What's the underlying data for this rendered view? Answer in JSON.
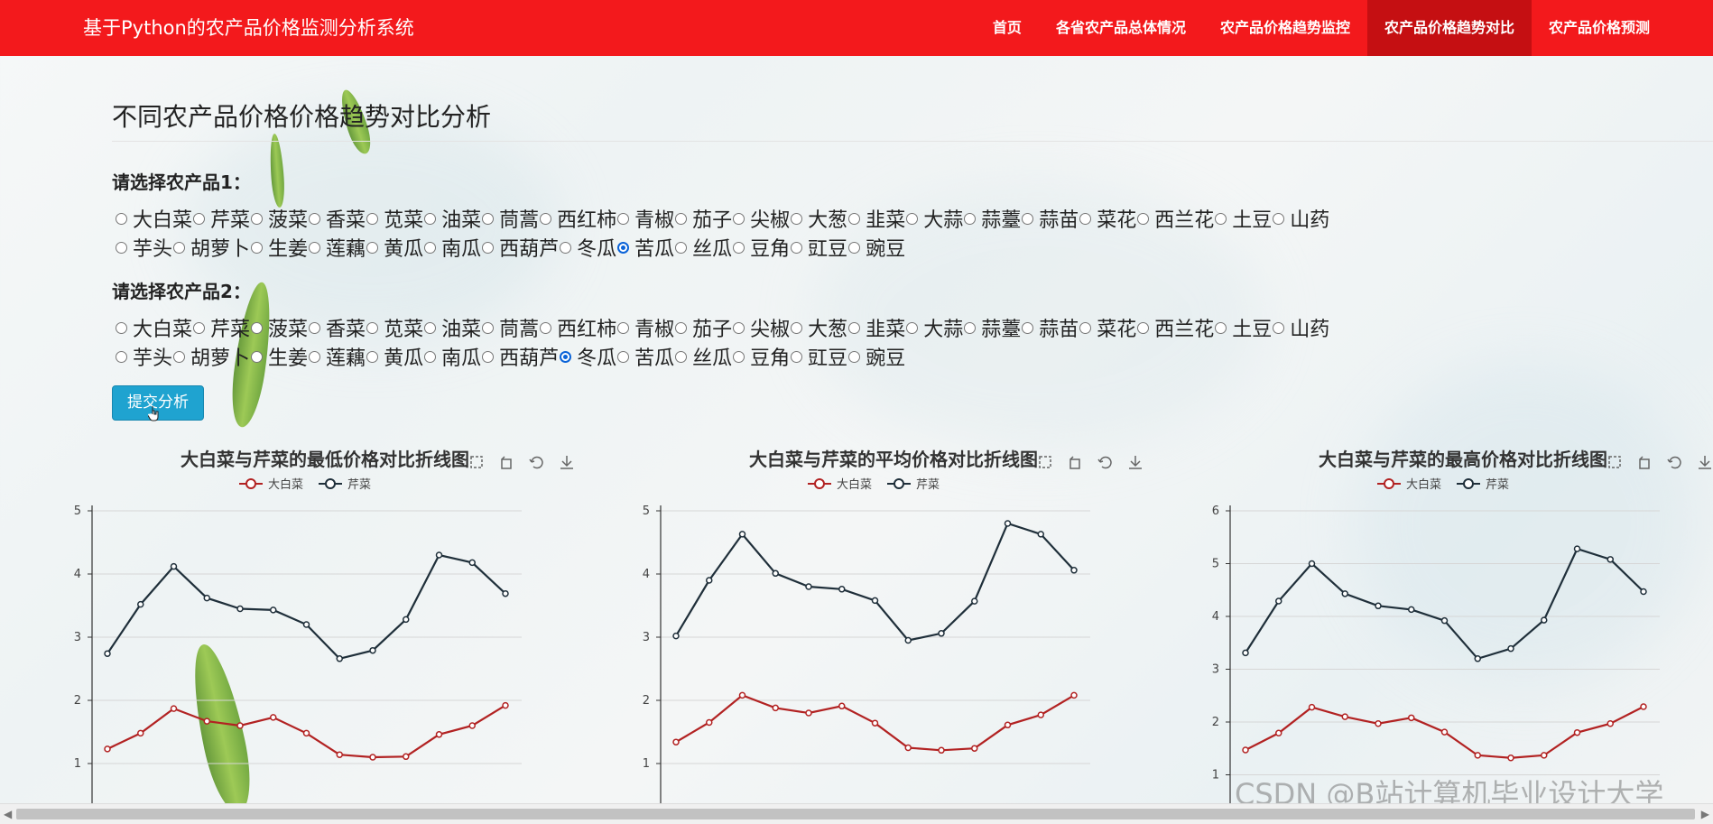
{
  "navbar": {
    "brand": "基于Python的农产品价格监测分析系统",
    "items": [
      {
        "label": "首页",
        "active": false
      },
      {
        "label": "各省农产品总体情况",
        "active": false
      },
      {
        "label": "农产品价格趋势监控",
        "active": false
      },
      {
        "label": "农产品价格趋势对比",
        "active": true
      },
      {
        "label": "农产品价格预测",
        "active": false
      }
    ]
  },
  "page_title": "不同农产品价格价格趋势对比分析",
  "product1": {
    "label": "请选择农产品1：",
    "selected": "苦瓜"
  },
  "product2": {
    "label": "请选择农产品2：",
    "selected": "冬瓜"
  },
  "options_row1": [
    "大白菜",
    "芹菜",
    "菠菜",
    "香菜",
    "苋菜",
    "油菜",
    "茼蒿",
    "西红柿",
    "青椒",
    "茄子",
    "尖椒",
    "大葱",
    "韭菜",
    "大蒜",
    "蒜薹",
    "蒜苗",
    "菜花",
    "西兰花",
    "土豆",
    "山药"
  ],
  "options_row2": [
    "芋头",
    "胡萝卜",
    "生姜",
    "莲藕",
    "黄瓜",
    "南瓜",
    "西葫芦",
    "冬瓜",
    "苦瓜",
    "丝瓜",
    "豆角",
    "豇豆",
    "豌豆"
  ],
  "submit_label": "提交分析",
  "colors": {
    "navbar": "#f3191c",
    "nav_active": "#c50f12",
    "series1": "#b22222",
    "series2": "#1f2f3a",
    "button": "#1fa3d0"
  },
  "chart_data": [
    {
      "type": "line",
      "title": "大白菜与芹菜的最低价格对比折线图",
      "ylim": [
        0,
        5
      ],
      "yticks": [
        1,
        2,
        3,
        4,
        5
      ],
      "series": [
        {
          "name": "大白菜",
          "values": [
            1.23,
            1.48,
            1.87,
            1.67,
            1.6,
            1.73,
            1.48,
            1.14,
            1.1,
            1.11,
            1.46,
            1.6,
            1.92
          ]
        },
        {
          "name": "芹菜",
          "values": [
            2.74,
            3.52,
            4.12,
            3.62,
            3.45,
            3.43,
            3.2,
            2.66,
            2.79,
            3.28,
            4.3,
            4.18,
            3.69
          ]
        }
      ],
      "legend": "top-center",
      "toolbox": [
        "zoom-icon",
        "zoom-reset-icon",
        "refresh-icon",
        "download-icon"
      ]
    },
    {
      "type": "line",
      "title": "大白菜与芹菜的平均价格对比折线图",
      "ylim": [
        0,
        5
      ],
      "yticks": [
        1,
        2,
        3,
        4,
        5
      ],
      "series": [
        {
          "name": "大白菜",
          "values": [
            1.34,
            1.65,
            2.08,
            1.88,
            1.8,
            1.91,
            1.64,
            1.25,
            1.21,
            1.24,
            1.61,
            1.77,
            2.08
          ]
        },
        {
          "name": "芹菜",
          "values": [
            3.02,
            3.9,
            4.63,
            4.01,
            3.8,
            3.76,
            3.58,
            2.95,
            3.06,
            3.57,
            4.8,
            4.63,
            4.06
          ]
        }
      ],
      "legend": "top-center",
      "toolbox": [
        "zoom-icon",
        "zoom-reset-icon",
        "refresh-icon",
        "download-icon"
      ]
    },
    {
      "type": "line",
      "title": "大白菜与芹菜的最高价格对比折线图",
      "ylim": [
        0,
        6
      ],
      "yticks": [
        1,
        2,
        3,
        4,
        5,
        6
      ],
      "series": [
        {
          "name": "大白菜",
          "values": [
            1.47,
            1.79,
            2.28,
            2.1,
            1.97,
            2.08,
            1.81,
            1.37,
            1.32,
            1.37,
            1.8,
            1.97,
            2.29
          ]
        },
        {
          "name": "芹菜",
          "values": [
            3.31,
            4.29,
            5.0,
            4.43,
            4.2,
            4.13,
            3.92,
            3.2,
            3.39,
            3.93,
            5.28,
            5.08,
            4.47
          ]
        }
      ],
      "legend": "top-center",
      "toolbox": [
        "zoom-icon",
        "zoom-reset-icon",
        "refresh-icon",
        "download-icon"
      ]
    }
  ],
  "watermark": "CSDN @B站计算机毕业设计大学"
}
